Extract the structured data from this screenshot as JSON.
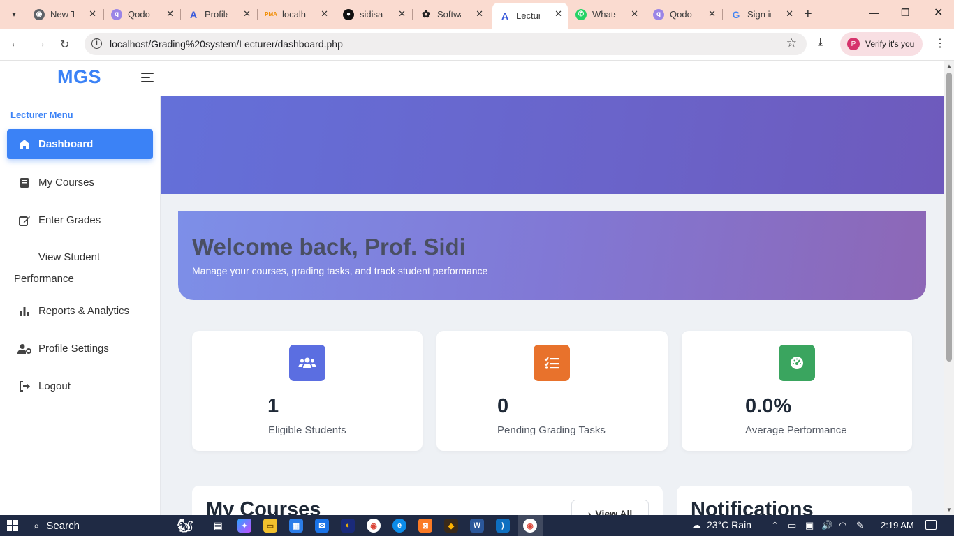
{
  "browser": {
    "tabs": [
      {
        "label": "New Tab",
        "favicon": "chrome-icon",
        "color": "#3c3c3c"
      },
      {
        "label": "Qodo",
        "favicon": "qodo-icon",
        "color": "#7b61d1"
      },
      {
        "label": "Profile",
        "favicon": "arc-icon",
        "color": "#3b5bdb"
      },
      {
        "label": "localhost",
        "favicon": "phpmyadmin-icon",
        "color": "#f08c00"
      },
      {
        "label": "sidisam",
        "favicon": "github-icon",
        "color": "#111111"
      },
      {
        "label": "Software",
        "favicon": "openai-icon",
        "color": "#222222"
      },
      {
        "label": "Lecturer",
        "favicon": "arc-icon",
        "color": "#3b5bdb",
        "active": true
      },
      {
        "label": "WhatsApp",
        "favicon": "whatsapp-icon",
        "color": "#25d366"
      },
      {
        "label": "Qodo",
        "favicon": "qodo-icon",
        "color": "#7b61d1"
      },
      {
        "label": "Sign in",
        "favicon": "google-icon",
        "color": "#4285f4"
      }
    ],
    "url": "localhost/Grading%20system/Lecturer/dashboard.php",
    "verify_label": "Verify it's you",
    "avatar_letter": "P"
  },
  "app": {
    "logo": "MGS",
    "sidebar": {
      "title": "Lecturer Menu",
      "items": [
        {
          "label": "Dashboard",
          "icon": "home-icon",
          "active": true
        },
        {
          "label": "My Courses",
          "icon": "book-icon"
        },
        {
          "label": "Enter Grades",
          "icon": "edit-icon"
        },
        {
          "label": "View Student",
          "label2": "Performance",
          "icon": "none"
        },
        {
          "label": "Reports & Analytics",
          "icon": "bar-chart-icon"
        },
        {
          "label": "Profile Settings",
          "icon": "user-cog-icon"
        },
        {
          "label": "Logout",
          "icon": "logout-icon"
        }
      ]
    },
    "welcome": {
      "title": "Welcome back, Prof. Sidi",
      "subtitle": "Manage your courses, grading tasks, and track student performance"
    },
    "stats": [
      {
        "value": "1",
        "label": "Eligible Students",
        "icon": "users-icon",
        "color": "#5b6ee1"
      },
      {
        "value": "0",
        "label": "Pending Grading Tasks",
        "icon": "tasks-icon",
        "color": "#e8722c"
      },
      {
        "value": "0.0%",
        "label": "Average Performance",
        "icon": "gauge-icon",
        "color": "#3aa55f"
      }
    ],
    "courses_panel": {
      "title": "My Courses",
      "view_all": "View All"
    },
    "notifications_panel": {
      "title": "Notifications"
    }
  },
  "taskbar": {
    "search_label": "Search",
    "weather": "23°C  Rain",
    "time": "2:19 AM"
  }
}
